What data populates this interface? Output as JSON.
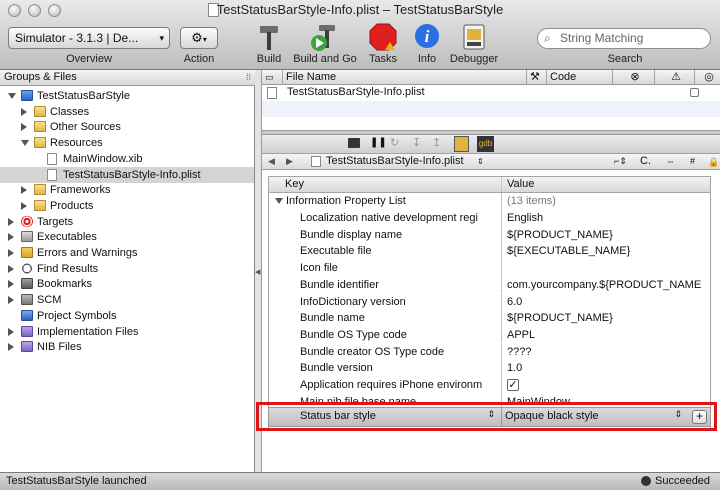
{
  "window": {
    "title": "TestStatusBarStyle-Info.plist – TestStatusBarStyle"
  },
  "toolbar": {
    "overview_popup": "Simulator - 3.1.3 | De...",
    "overview_label": "Overview",
    "action_label": "Action",
    "build_label": "Build",
    "build_and_go_label": "Build and Go",
    "tasks_label": "Tasks",
    "info_label": "Info",
    "debugger_label": "Debugger",
    "search_placeholder": "String Matching",
    "search_label": "Search"
  },
  "groups": {
    "header": "Groups & Files",
    "items": [
      {
        "label": "TestStatusBarStyle",
        "level": 0,
        "expanded": true,
        "icon": "project-icon"
      },
      {
        "label": "Classes",
        "level": 1,
        "expanded": false,
        "icon": "folder-icon"
      },
      {
        "label": "Other Sources",
        "level": 1,
        "expanded": false,
        "icon": "folder-icon"
      },
      {
        "label": "Resources",
        "level": 1,
        "expanded": true,
        "icon": "folder-icon"
      },
      {
        "label": "MainWindow.xib",
        "level": 2,
        "icon": "xib-file-icon"
      },
      {
        "label": "TestStatusBarStyle-Info.plist",
        "level": 2,
        "icon": "plist-file-icon",
        "selected": true
      },
      {
        "label": "Frameworks",
        "level": 1,
        "expanded": false,
        "icon": "folder-icon"
      },
      {
        "label": "Products",
        "level": 1,
        "expanded": false,
        "icon": "folder-icon"
      },
      {
        "label": "Targets",
        "level": 0,
        "expanded": false,
        "icon": "target-icon"
      },
      {
        "label": "Executables",
        "level": 0,
        "expanded": false,
        "icon": "executables-icon"
      },
      {
        "label": "Errors and Warnings",
        "level": 0,
        "expanded": false,
        "icon": "warning-icon"
      },
      {
        "label": "Find Results",
        "level": 0,
        "expanded": false,
        "icon": "magnifier-icon"
      },
      {
        "label": "Bookmarks",
        "level": 0,
        "expanded": false,
        "icon": "bookmark-icon"
      },
      {
        "label": "SCM",
        "level": 0,
        "expanded": false,
        "icon": "scm-icon"
      },
      {
        "label": "Project Symbols",
        "level": 0,
        "icon": "symbols-icon"
      },
      {
        "label": "Implementation Files",
        "level": 0,
        "expanded": false,
        "icon": "implementation-files-icon"
      },
      {
        "label": "NIB Files",
        "level": 0,
        "expanded": false,
        "icon": "nib-files-icon"
      }
    ]
  },
  "file_list": {
    "col_file_name": "File Name",
    "col_code": "Code",
    "rows": [
      "TestStatusBarStyle-Info.plist"
    ]
  },
  "editor": {
    "nav_file": "TestStatusBarStyle-Info.plist",
    "nav_symbol": "C.",
    "dbg_label": "gdb"
  },
  "plist": {
    "col_key": "Key",
    "col_value": "Value",
    "root_key": "Information Property List",
    "root_value": "(13 items)",
    "rows": [
      {
        "key": "Localization native development regi",
        "value": "English"
      },
      {
        "key": "Bundle display name",
        "value": "${PRODUCT_NAME}"
      },
      {
        "key": "Executable file",
        "value": "${EXECUTABLE_NAME}"
      },
      {
        "key": "Icon file",
        "value": ""
      },
      {
        "key": "Bundle identifier",
        "value": "com.yourcompany.${PRODUCT_NAME"
      },
      {
        "key": "InfoDictionary version",
        "value": "6.0"
      },
      {
        "key": "Bundle name",
        "value": "${PRODUCT_NAME}"
      },
      {
        "key": "Bundle OS Type code",
        "value": "APPL"
      },
      {
        "key": "Bundle creator OS Type code",
        "value": "????"
      },
      {
        "key": "Bundle version",
        "value": "1.0"
      },
      {
        "key": "Application requires iPhone environm",
        "value": "✓",
        "checkbox": true
      },
      {
        "key": "Main nib file base name",
        "value": "MainWindow"
      }
    ],
    "selected_row": {
      "key": "Status bar style",
      "value": "Opaque black style"
    }
  },
  "status": {
    "left": "TestStatusBarStyle launched",
    "right": "Succeeded"
  },
  "colors": {
    "highlight_border": "#e01414"
  }
}
